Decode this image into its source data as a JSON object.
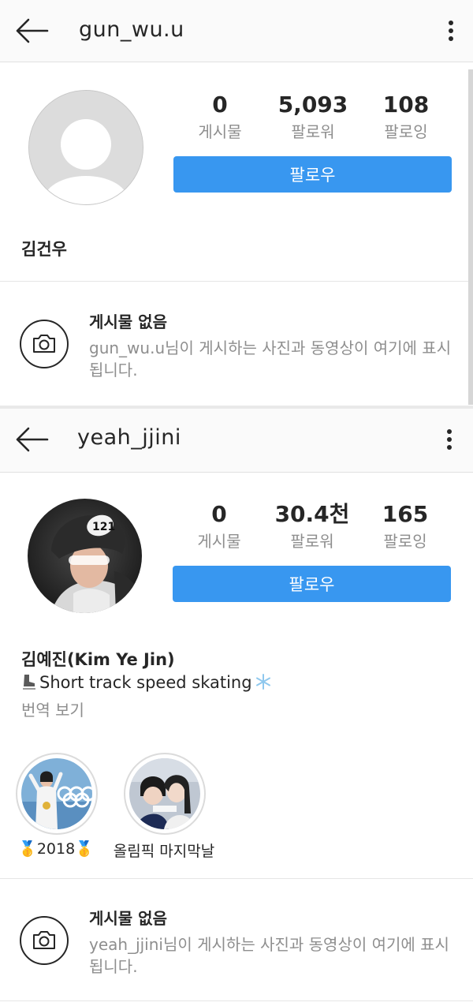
{
  "profile1": {
    "username": "gun_wu.u",
    "stats": [
      {
        "value": "0",
        "label": "게시물"
      },
      {
        "value": "5,093",
        "label": "팔로워"
      },
      {
        "value": "108",
        "label": "팔로잉"
      }
    ],
    "follow_label": "팔로우",
    "full_name": "김건우",
    "no_posts_title": "게시물 없음",
    "no_posts_desc": "gun_wu.u님이 게시하는 사진과 동영상이 여기에 표시됩니다."
  },
  "profile2": {
    "username": "yeah_jjini",
    "avatar_badge": "121",
    "stats": [
      {
        "value": "0",
        "label": "게시물"
      },
      {
        "value": "30.4천",
        "label": "팔로워"
      },
      {
        "value": "165",
        "label": "팔로잉"
      }
    ],
    "follow_label": "팔로우",
    "full_name": "김예진(Kim Ye Jin)",
    "bio_text": "Short track speed skating",
    "bio_emoji_left": "skate",
    "bio_emoji_right": "snowflake",
    "translate_label": "번역 보기",
    "highlights": [
      {
        "label": "🥇2018🥇",
        "icon": "gold-medal-olympic-rings"
      },
      {
        "label": "올림픽 마지막날",
        "icon": "two-skaters-selfie"
      }
    ],
    "no_posts_title": "게시물 없음",
    "no_posts_desc": "yeah_jjini님이 게시하는 사진과 동영상이 여기에 표시됩니다."
  },
  "colors": {
    "follow_button": "#3897f0",
    "text_primary": "#262626",
    "text_secondary": "#8e8e8e",
    "topbar_bg": "#fafafa"
  }
}
